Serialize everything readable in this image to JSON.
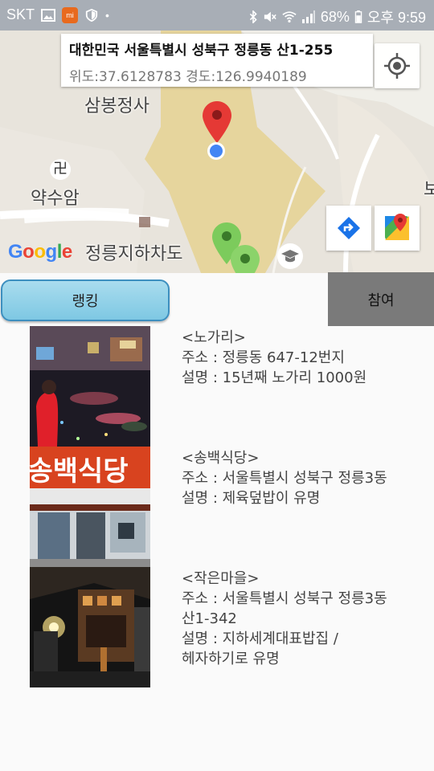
{
  "status_bar": {
    "carrier": "SKT",
    "battery": "68%",
    "time": "오후 9:59"
  },
  "map": {
    "info_title": "대한민국 서울특별시 성북구 정릉동 산1-255",
    "info_coords": "위도:37.6128783 경도:126.9940189",
    "labels": {
      "temple": "삼봉정사",
      "swastika": "卍",
      "yaksuam": "약수암",
      "underpass": "정릉지하차도",
      "edge": "보"
    },
    "google_logo": [
      "G",
      "o",
      "o",
      "g",
      "l",
      "e"
    ],
    "google_colors": [
      "#4285F4",
      "#EA4335",
      "#FBBC05",
      "#4285F4",
      "#34A853",
      "#EA4335"
    ],
    "icons": {
      "my_location": "my-location-icon",
      "directions": "directions-icon",
      "google_maps": "google-maps-icon",
      "red_marker": "map-marker-icon",
      "green_markers": "map-marker-green-icon"
    }
  },
  "tabs": {
    "ranking": "랭킹",
    "join": "참여"
  },
  "restaurants": [
    {
      "name": "<노가리>",
      "address": "주소 : 정릉동 647-12번지",
      "address2": "",
      "description": "설명 : 15년째 노가리 1000원",
      "description2": ""
    },
    {
      "name": "<송백식당>",
      "address": "주소 : 서울특별시 성북구 정릉3동",
      "address2": "",
      "description": "설명 : 제육덮밥이 유명",
      "description2": "",
      "sign_text": "송백식당"
    },
    {
      "name": "<작은마을>",
      "address": "주소 : 서울특별시 성북구 정릉3동",
      "address2": "산1-342",
      "description": "설명 : 지하세계대표밥집 /",
      "description2": "헤자하기로 유명"
    }
  ]
}
